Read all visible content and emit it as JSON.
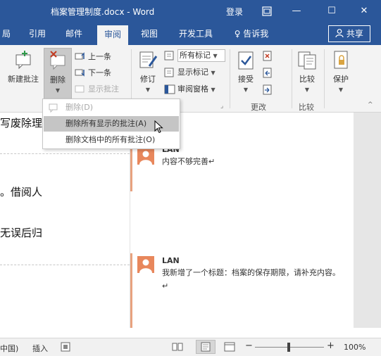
{
  "window": {
    "title": "档案管理制度.docx - Word",
    "login": "登录",
    "restore_icon": "restore-icon",
    "minimize_glyph": "—",
    "maximize_glyph": "☐",
    "close_glyph": "✕"
  },
  "tabs": [
    {
      "label": "局"
    },
    {
      "label": "引用"
    },
    {
      "label": "邮件"
    },
    {
      "label": "审阅",
      "active": true
    },
    {
      "label": "视图"
    },
    {
      "label": "开发工具"
    },
    {
      "label": "♀ 告诉我"
    }
  ],
  "share_label": "共享",
  "ribbon": {
    "new_comment": "新建批注",
    "delete": "删除",
    "prev": "上一条",
    "next": "下一条",
    "show_comments": "显示批注",
    "track": "修订",
    "all_markup": "所有标记",
    "show_markup": "显示标记",
    "review_pane": "审阅窗格",
    "accept": "接受",
    "changes_group": "更改",
    "compare": "比较",
    "compare_group": "比较",
    "protect": "保护"
  },
  "dropdown": {
    "items": [
      {
        "label": "删除(D)"
      },
      {
        "label": "删除所有显示的批注(A)"
      },
      {
        "label": "删除文档中的所有批注(O)"
      }
    ]
  },
  "document": {
    "lines": [
      "写废除理",
      "。借阅人",
      "无误后归"
    ]
  },
  "comments": [
    {
      "author": "LAN",
      "text": "内容不够完善↵"
    },
    {
      "author": "LAN",
      "text": "我新增了一个标题：档案的保存期限，请补充内容。↵"
    }
  ],
  "statusbar": {
    "language": "中国)",
    "insert_mode": "插入",
    "zoom_minus": "−",
    "zoom_plus": "+",
    "zoom": "100%"
  },
  "colors": {
    "brand": "#2b579a",
    "comment_accent": "#e8875c"
  }
}
